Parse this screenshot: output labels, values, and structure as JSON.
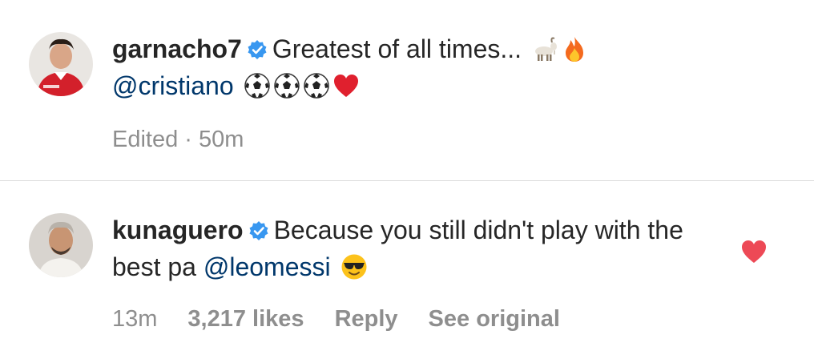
{
  "comments": [
    {
      "username": "garnacho7",
      "text": "Greatest of all times...",
      "mention": "@cristiano",
      "emojis": [
        "goat-emoji",
        "fire-emoji",
        "soccer-ball-emoji",
        "soccer-ball-emoji",
        "soccer-ball-emoji",
        "red-heart-emoji"
      ],
      "meta": {
        "edited": "Edited · 50m"
      }
    },
    {
      "username": "kunaguero",
      "text": "Because you still didn't play with the best pa",
      "mention": "@leomessi",
      "emojis": [
        "sunglasses-face-emoji"
      ],
      "meta": {
        "time": "13m",
        "likes": "3,217 likes",
        "reply": "Reply",
        "see_original": "See original"
      },
      "liked": true
    }
  ],
  "colors": {
    "like_heart": "#ed4956",
    "verified": "#3897f0",
    "mention": "#00376b",
    "meta": "#8e8e8e"
  }
}
